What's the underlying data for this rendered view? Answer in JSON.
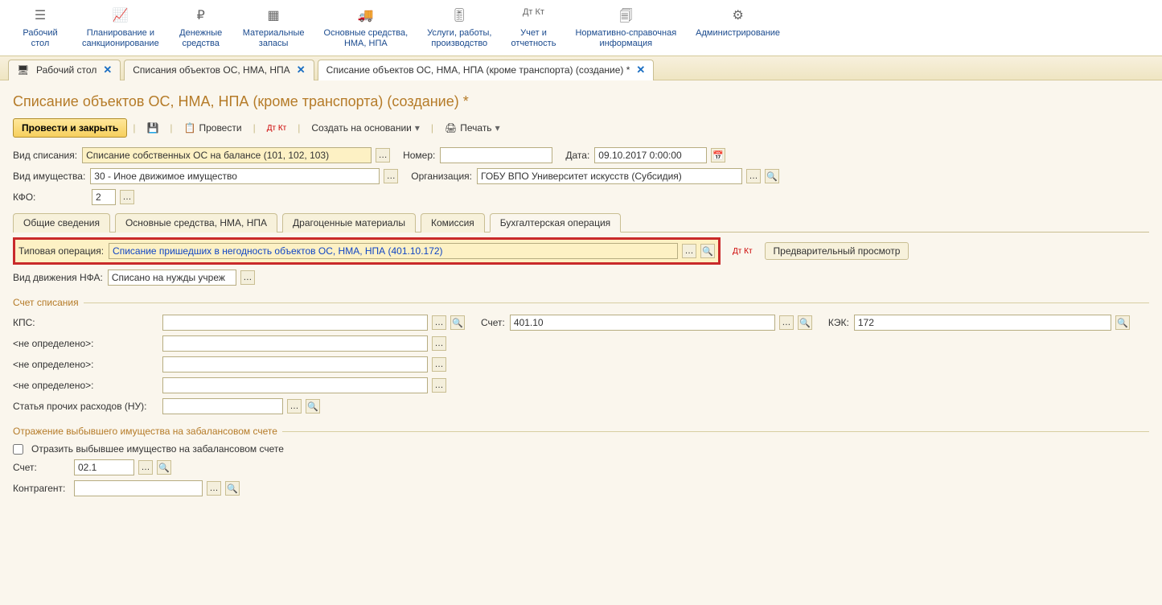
{
  "nav": [
    {
      "label": "Рабочий\nстол"
    },
    {
      "label": "Планирование и\nсанкционирование"
    },
    {
      "label": "Денежные\nсредства"
    },
    {
      "label": "Материальные\nзапасы"
    },
    {
      "label": "Основные средства,\nНМА, НПА"
    },
    {
      "label": "Услуги, работы,\nпроизводство"
    },
    {
      "label": "Учет и\nотчетность"
    },
    {
      "label": "Нормативно-справочная\nинформация"
    },
    {
      "label": "Администрирование"
    }
  ],
  "tabs": {
    "t0": "Рабочий стол",
    "t1": "Списания объектов ОС, НМА, НПА",
    "t2": "Списание объектов ОС, НМА, НПА (кроме транспорта) (создание) *"
  },
  "page_title": "Списание объектов ОС, НМА, НПА (кроме транспорта) (создание) *",
  "toolbar": {
    "post_close": "Провести и закрыть",
    "post": "Провести",
    "create_based": "Создать на основании",
    "print": "Печать"
  },
  "form": {
    "vid_spisaniya_lbl": "Вид списания:",
    "vid_spisaniya_val": "Списание собственных ОС на балансе (101, 102, 103)",
    "nomer_lbl": "Номер:",
    "data_lbl": "Дата:",
    "data_val": "09.10.2017  0:00:00",
    "vid_imush_lbl": "Вид имущества:",
    "vid_imush_val": "30 - Иное движимое имущество",
    "org_lbl": "Организация:",
    "org_val": "ГОБУ ВПО Университет искусств (Субсидия)",
    "kfo_lbl": "КФО:",
    "kfo_val": "2"
  },
  "subtabs": {
    "s0": "Общие сведения",
    "s1": "Основные средства, НМА, НПА",
    "s2": "Драгоценные материалы",
    "s3": "Комиссия",
    "s4": "Бухгалтерская операция"
  },
  "operation": {
    "typ_lbl": "Типовая операция:",
    "typ_val": "Списание пришедших в негодность объектов ОС, НМА, НПА (401.10.172)",
    "preview": "Предварительный просмотр",
    "vid_dvij_lbl": "Вид движения НФА:",
    "vid_dvij_val": "Списано на нужды учреж"
  },
  "schet": {
    "section": "Счет списания",
    "kps_lbl": "КПС:",
    "schet_lbl": "Счет:",
    "schet_val": "401.10",
    "kek_lbl": "КЭК:",
    "kek_val": "172",
    "nd": "<не определено>:",
    "stat_lbl": "Статья прочих расходов (НУ):"
  },
  "zabal": {
    "section": "Отражение выбывшего имущества на забалансовом счете",
    "chk": "Отразить выбывшее имущество на забалансовом счете",
    "schet_lbl": "Счет:",
    "schet_val": "02.1",
    "kontr_lbl": "Контрагент:"
  }
}
